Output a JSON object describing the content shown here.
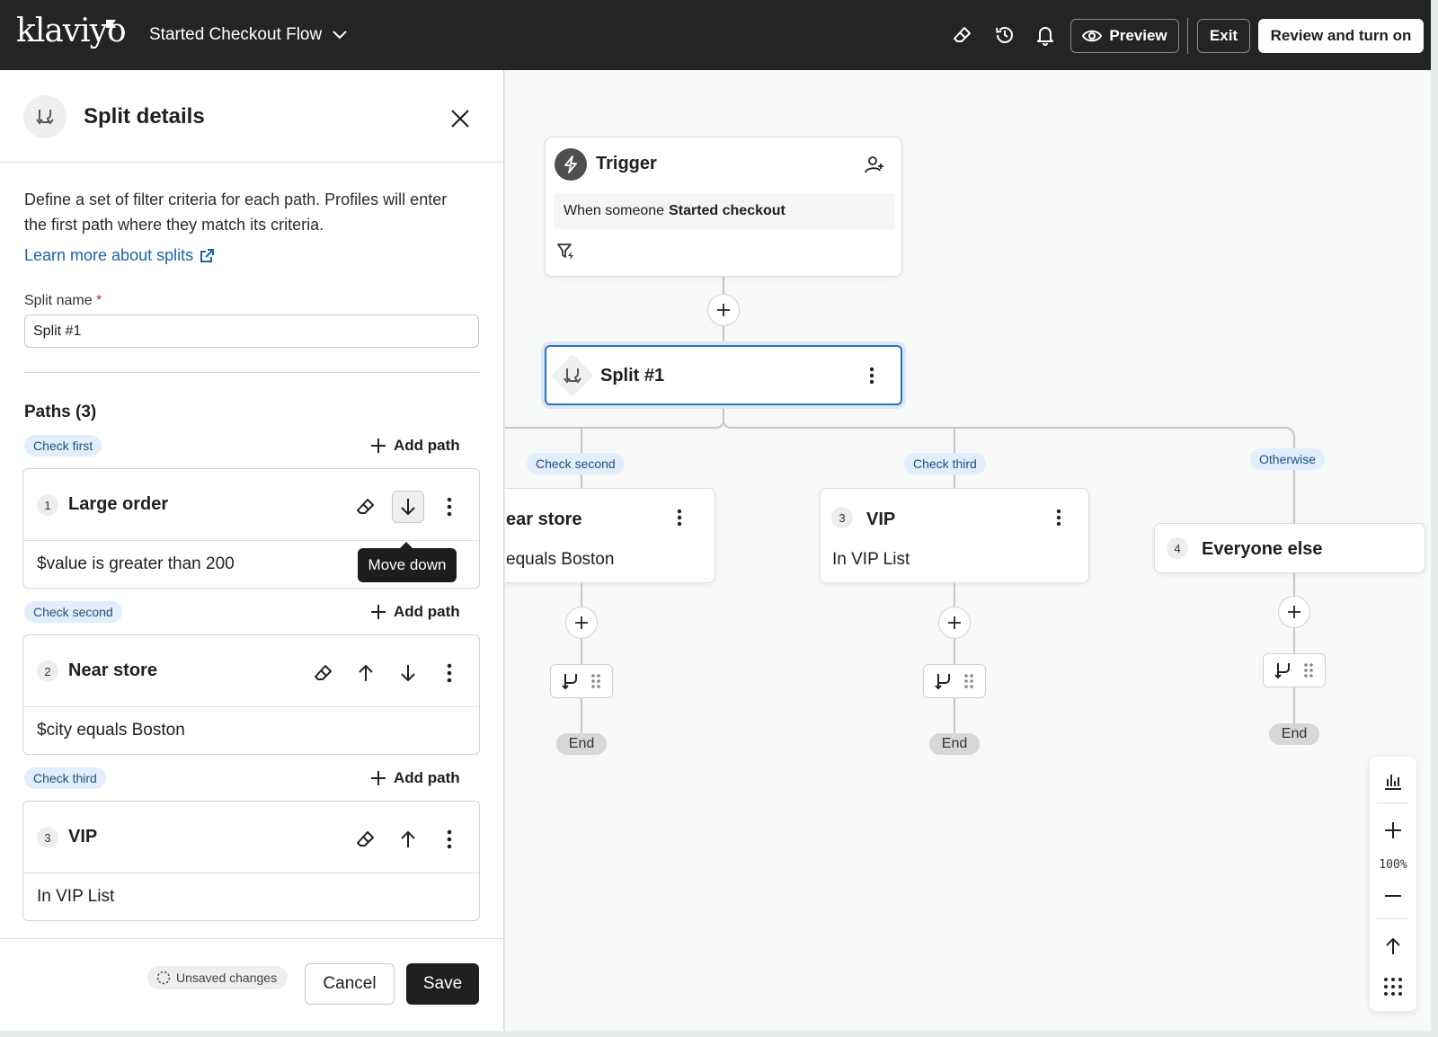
{
  "header": {
    "logo": "klaviyo",
    "flow_name": "Started Checkout Flow",
    "preview_label": "Preview",
    "exit_label": "Exit",
    "review_label": "Review and turn on"
  },
  "panel": {
    "title": "Split details",
    "description": "Define a set of filter criteria for each path. Profiles will enter the first path where they match its criteria.",
    "learn_more": "Learn more about splits",
    "split_name_label": "Split name",
    "required_mark": "*",
    "split_name_value": "Split #1",
    "paths_title": "Paths (3)",
    "add_path_label": "Add path",
    "paths": [
      {
        "check_label": "Check first",
        "number": "1",
        "name": "Large order",
        "criteria": "$value is greater than 200"
      },
      {
        "check_label": "Check second",
        "number": "2",
        "name": "Near store",
        "criteria": "$city equals Boston"
      },
      {
        "check_label": "Check third",
        "number": "3",
        "name": "VIP",
        "criteria": "In VIP List"
      }
    ],
    "tooltip": "Move down",
    "unsaved": "Unsaved changes",
    "cancel_label": "Cancel",
    "save_label": "Save"
  },
  "canvas": {
    "trigger": {
      "title": "Trigger",
      "body_prefix": "When someone",
      "body_event": "Started checkout"
    },
    "split_node": {
      "name": "Split #1"
    },
    "branches": [
      {
        "chip": "Check second",
        "name": "ear store",
        "criteria": "equals Boston",
        "end": "End"
      },
      {
        "chip": "Check third",
        "number": "3",
        "name": "VIP",
        "criteria": "In VIP List",
        "end": "End"
      },
      {
        "chip": "Otherwise",
        "number": "4",
        "name": "Everyone else",
        "end": "End"
      }
    ],
    "zoom_level": "100%"
  },
  "colors": {
    "topbar": "#232426",
    "accent_link": "#1b63a8",
    "chip_bg": "#e2eefb",
    "selected_border": "#2e6fb8"
  }
}
